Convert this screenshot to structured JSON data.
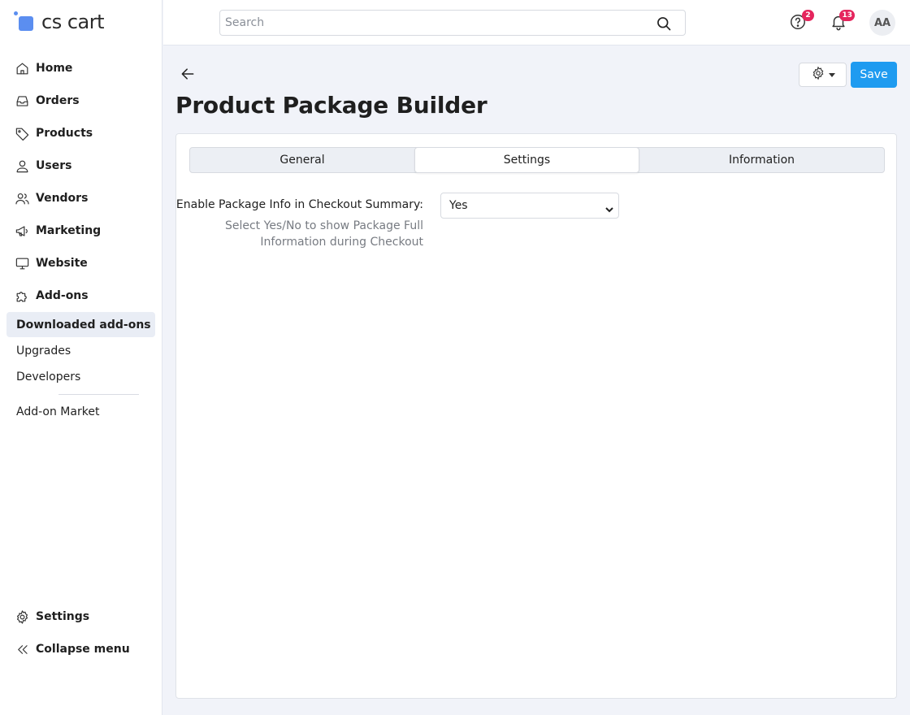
{
  "app": {
    "logo_text": "cs cart",
    "accent_color": "#1f9bf0",
    "logo_color": "#5b8ef0"
  },
  "header": {
    "search_placeholder": "Search",
    "help_badge": "2",
    "notifications_badge": "13",
    "avatar_initials": "AA"
  },
  "sidebar": {
    "items": [
      {
        "label": "Home",
        "icon": "home-icon"
      },
      {
        "label": "Orders",
        "icon": "inbox-icon"
      },
      {
        "label": "Products",
        "icon": "tag-icon"
      },
      {
        "label": "Users",
        "icon": "user-icon"
      },
      {
        "label": "Vendors",
        "icon": "users-icon"
      },
      {
        "label": "Marketing",
        "icon": "megaphone-icon"
      },
      {
        "label": "Website",
        "icon": "monitor-icon"
      },
      {
        "label": "Add-ons",
        "icon": "puzzle-icon"
      }
    ],
    "sub_items": [
      {
        "label": "Downloaded add-ons",
        "active": true
      },
      {
        "label": "Upgrades"
      },
      {
        "label": "Developers"
      },
      {
        "label": "Add-on Market"
      }
    ],
    "bottom": [
      {
        "label": "Settings",
        "icon": "gear-icon"
      },
      {
        "label": "Collapse menu",
        "icon": "double-chevron-left-icon"
      }
    ]
  },
  "page": {
    "title": "Product Package Builder",
    "save_label": "Save",
    "tabs": [
      {
        "label": "General"
      },
      {
        "label": "Settings",
        "active": true
      },
      {
        "label": "Information"
      }
    ],
    "setting": {
      "label": "Enable Package Info in Checkout Summary:",
      "help": "Select Yes/No to show Package Full Information during Checkout",
      "value": "Yes"
    }
  }
}
